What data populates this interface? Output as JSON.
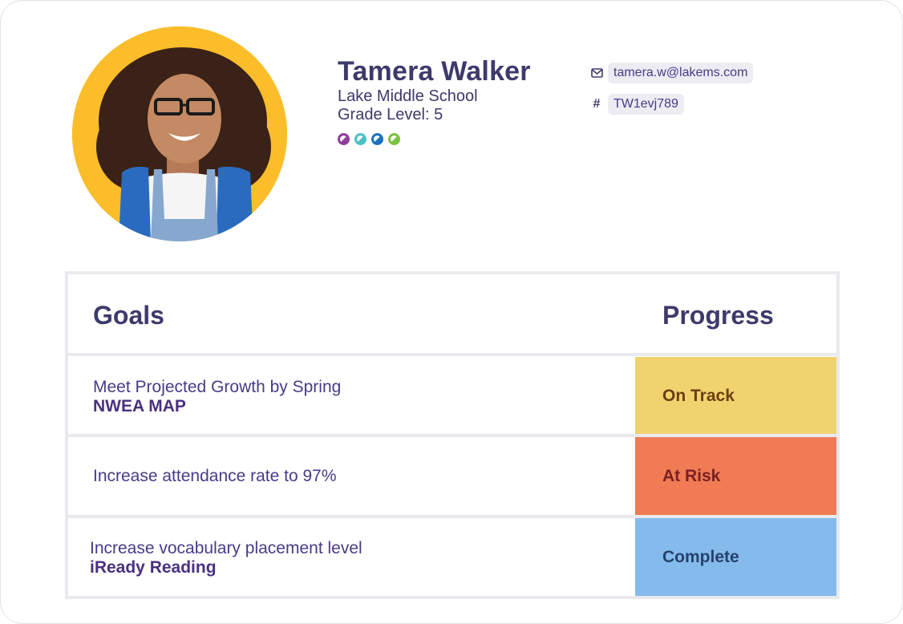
{
  "profile": {
    "name": "Tamera Walker",
    "school": "Lake Middle School",
    "grade": "Grade Level: 5",
    "avatar_alt": "Student photo",
    "indicator_dots": [
      {
        "color": "#8e3e9a"
      },
      {
        "color": "#4bbfc3"
      },
      {
        "color": "#1f6fbf"
      },
      {
        "color": "#7cc242"
      }
    ]
  },
  "contact": {
    "email_icon": "mail-icon",
    "email": "tamera.w@lakems.com",
    "id_icon": "hash-icon",
    "id_symbol": "#",
    "student_id": "TW1evj789"
  },
  "goals_table": {
    "header_goals": "Goals",
    "header_progress": "Progress",
    "rows": [
      {
        "title": "Meet Projected Growth by Spring",
        "source": "NWEA MAP",
        "status": "On Track",
        "status_bg": "#f0d36e",
        "status_fg": "#6b3d0f"
      },
      {
        "title": "Increase attendance rate to 97%",
        "source": "",
        "status": "At Risk",
        "status_bg": "#f07b55",
        "status_fg": "#7a2222"
      },
      {
        "title": "Increase vocabulary placement level",
        "source": "iReady Reading",
        "status": "Complete",
        "status_bg": "#85bbec",
        "status_fg": "#24426c"
      }
    ]
  }
}
